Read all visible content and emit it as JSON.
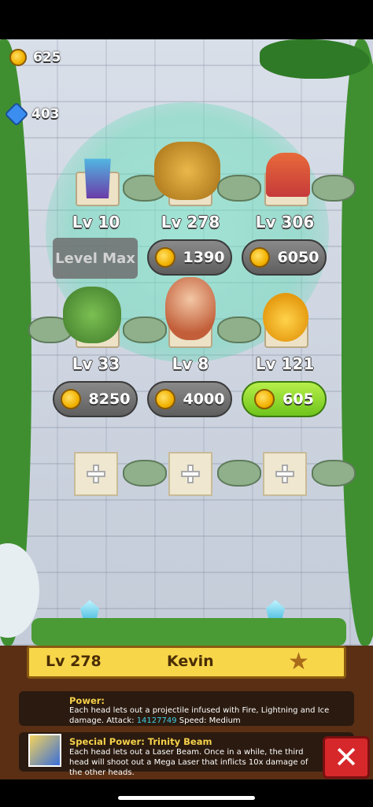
{
  "currencies": {
    "coins": "625",
    "gems": "403"
  },
  "heroes": [
    {
      "level": "Lv 10",
      "cost": null,
      "state": "level-max",
      "button_label": "Level Max"
    },
    {
      "level": "Lv 278",
      "cost": "1390",
      "state": "upgrade"
    },
    {
      "level": "Lv 306",
      "cost": "6050",
      "state": "upgrade"
    },
    {
      "level": "Lv 33",
      "cost": "8250",
      "state": "upgrade"
    },
    {
      "level": "Lv 8",
      "cost": "4000",
      "state": "upgrade"
    },
    {
      "level": "Lv 121",
      "cost": "605",
      "state": "affordable"
    }
  ],
  "empty_slots": 3,
  "selected": {
    "level": "Lv 278",
    "name": "Kevin",
    "power_title": "Power:",
    "power_desc_1": "Each head lets out a projectile infused with Fire, Lightning and Ice damage. Attack:",
    "power_attack": "14127749",
    "power_speed": " Speed: Medium",
    "special_title": "Special Power: Trinity Beam",
    "special_desc": "Each head lets out a Laser Beam. Once in a while, the third head will shoot out a Mega Laser that inflicts 10x damage of the other heads."
  },
  "colors": {
    "affordable": "#8fe12f",
    "disabled": "#6b6b6b",
    "highlight": "#3fd0e6",
    "ribbon": "#f7d64a",
    "close": "#d6282b"
  },
  "icons": {
    "coin": "coin-icon",
    "gem": "gem-icon",
    "star": "star-icon",
    "close": "close-icon",
    "plus": "plus-icon"
  }
}
